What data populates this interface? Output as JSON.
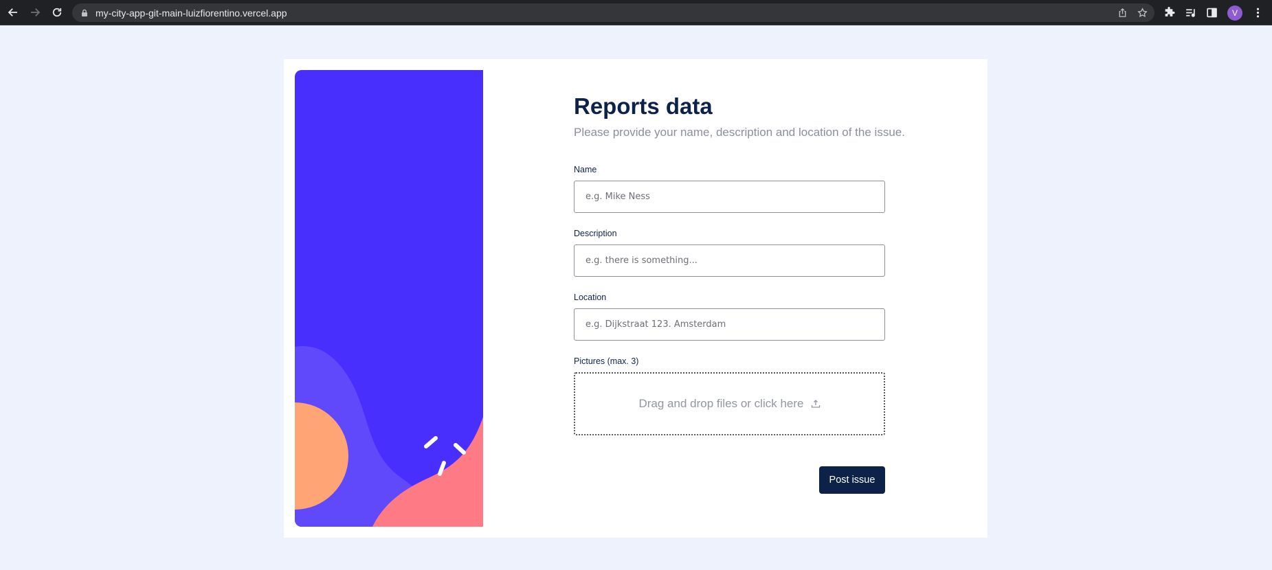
{
  "browser": {
    "url": "my-city-app-git-main-luizfiorentino.vercel.app",
    "profile_initial": "V"
  },
  "form": {
    "title": "Reports data",
    "subtitle": "Please provide your name, description and location of the issue.",
    "name": {
      "label": "Name",
      "placeholder": "e.g. Mike Ness",
      "value": ""
    },
    "description": {
      "label": "Description",
      "placeholder": "e.g. there is something...",
      "value": ""
    },
    "location": {
      "label": "Location",
      "placeholder": "e.g. Dijkstraat 123. Amsterdam",
      "value": ""
    },
    "pictures": {
      "label": "Pictures (max. 3)",
      "dropzone_text": "Drag and drop files or click here",
      "icon": "upload-icon"
    },
    "submit_label": "Post issue"
  },
  "colors": {
    "page_bg": "#edf2fd",
    "accent_navy": "#0d2249",
    "art_blue": "#482ffd",
    "art_lavender": "#6048fb",
    "art_peach": "#ffa475",
    "art_pink": "#fe7b86"
  }
}
